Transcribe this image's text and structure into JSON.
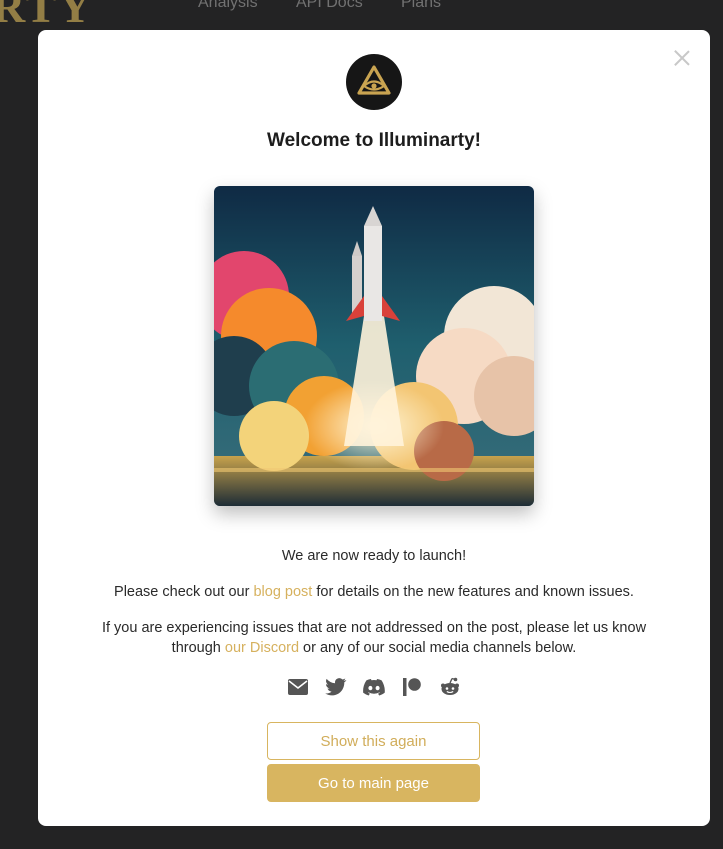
{
  "background": {
    "brand_fragment": "RTY",
    "nav": [
      "Analysis",
      "API Docs",
      "Plans"
    ]
  },
  "modal": {
    "title": "Welcome to Illuminarty!",
    "hero_image": "rocket-launch-illustration",
    "ready_text": "We are now ready to launch!",
    "blog_prefix": "Please check out our ",
    "blog_link": "blog post",
    "blog_suffix": " for details on the new features and known issues.",
    "issues_prefix": "If you are experiencing issues that are not addressed on the post, please let us know through ",
    "discord_link": "our Discord",
    "issues_suffix": " or any of our social media channels below.",
    "socials": [
      "email-icon",
      "twitter-icon",
      "discord-icon",
      "patreon-icon",
      "reddit-icon"
    ],
    "show_again_label": "Show this again",
    "main_page_label": "Go to main page"
  },
  "colors": {
    "accent": "#d8b560",
    "modal_bg": "#ffffff",
    "page_bg": "#2b2b2d",
    "icon": "#555555"
  }
}
